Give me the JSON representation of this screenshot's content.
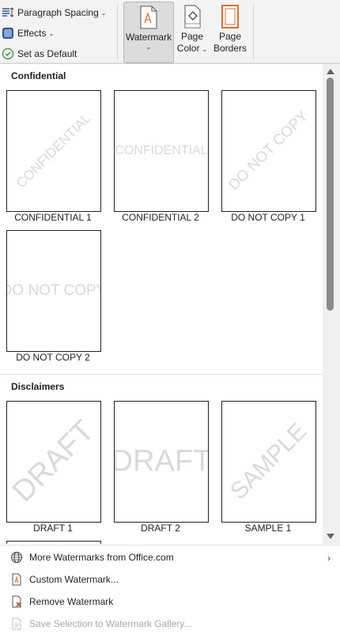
{
  "ribbon": {
    "paragraph_spacing": "Paragraph Spacing",
    "effects": "Effects",
    "set_as_default": "Set as Default",
    "watermark": "Watermark",
    "page_color_line1": "Page",
    "page_color_line2": "Color",
    "page_borders_line1": "Page",
    "page_borders_line2": "Borders"
  },
  "gallery": {
    "sections": [
      {
        "title": "Confidential",
        "items": [
          {
            "caption": "CONFIDENTIAL 1",
            "watermark": "CONFIDENTIAL",
            "style": "diagonal"
          },
          {
            "caption": "CONFIDENTIAL 2",
            "watermark": "CONFIDENTIAL",
            "style": "horizontal"
          },
          {
            "caption": "DO NOT COPY 1",
            "watermark": "DO NOT COPY",
            "style": "diagonal"
          },
          {
            "caption": "DO NOT COPY 2",
            "watermark": "DO NOT COPY",
            "style": "horizontal"
          }
        ]
      },
      {
        "title": "Disclaimers",
        "items": [
          {
            "caption": "DRAFT 1",
            "watermark": "DRAFT",
            "style": "diagonal"
          },
          {
            "caption": "DRAFT 2",
            "watermark": "DRAFT",
            "style": "horizontal"
          },
          {
            "caption": "SAMPLE 1",
            "watermark": "SAMPLE",
            "style": "diagonal"
          }
        ]
      }
    ]
  },
  "menu": {
    "more_watermarks": "More Watermarks from Office.com",
    "custom_watermark": "Custom Watermark...",
    "remove_watermark": "Remove Watermark",
    "save_selection": "Save Selection to Watermark Gallery..."
  },
  "colors": {
    "watermark_text": "#d9d9d9",
    "pressed_button": "#dcdcdc",
    "accent_orange": "#d9712b",
    "accent_blue": "#2b5797",
    "check_green": "#3a8a3a",
    "remove_red": "#c0392b"
  }
}
